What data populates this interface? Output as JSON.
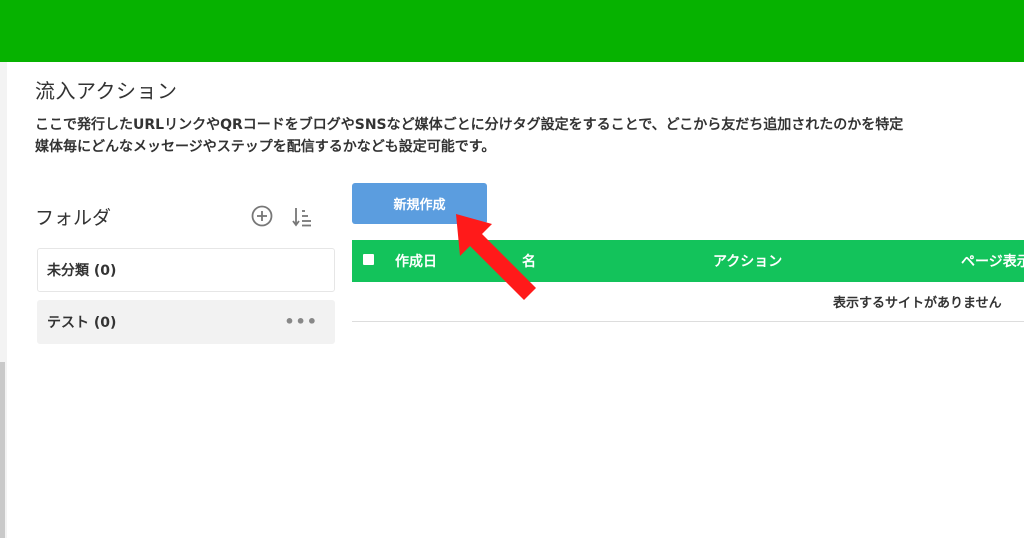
{
  "header": {
    "color": "#06b200"
  },
  "page": {
    "title": "流入アクション",
    "description_line1": "ここで発行したURLリンクやQRコードをブログやSNSなど媒体ごとに分けタグ設定をすることで、どこから友だち追加されたのかを特定",
    "description_line2": "媒体毎にどんなメッセージやステップを配信するかなども設定可能です。"
  },
  "sidebar": {
    "heading": "フォルダ",
    "add_icon": "plus-circle-icon",
    "sort_icon": "sort-icon",
    "folders": [
      {
        "label": "未分類 (0)"
      },
      {
        "label": "テスト (0)",
        "more": "•••"
      }
    ]
  },
  "toolbar": {
    "new_label": "新規作成",
    "new_color": "#5b9ddf"
  },
  "table": {
    "header_color": "#13c35b",
    "columns": [
      "作成日",
      "名",
      "アクション",
      "ページ表示"
    ],
    "empty_message": "表示するサイトがありません"
  },
  "annotation": {
    "arrow_icon": "red-arrow-icon",
    "arrow_color": "#ff1a1a"
  }
}
